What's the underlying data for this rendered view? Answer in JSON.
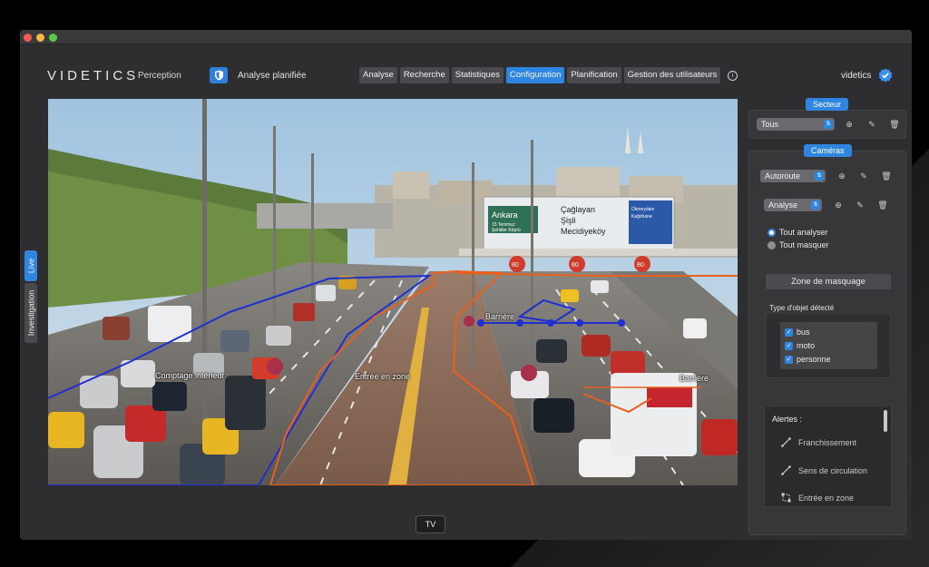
{
  "header": {
    "logo": "VIDETICS",
    "product": "Perception",
    "scheduled_label": "Analyse planifiée",
    "tabs": [
      {
        "label": "Analyse",
        "active": false
      },
      {
        "label": "Recherche",
        "active": false
      },
      {
        "label": "Statistiques",
        "active": false
      },
      {
        "label": "Configuration",
        "active": true
      },
      {
        "label": "Planification",
        "active": false
      },
      {
        "label": "Gestion des utilisateurs",
        "active": false
      }
    ],
    "info_icon": "i",
    "user": "videtics"
  },
  "side_tabs": {
    "live": "Live",
    "investigation": "Investigation"
  },
  "video": {
    "zones": {
      "counting": "Comptage intérieur",
      "entry": "Entrée en zone",
      "barrier_left": "Barrière",
      "barrier_right": "Barrière"
    },
    "signs": {
      "left": [
        "Ankara",
        "15 Temmuz",
        "Şehitler Köprü"
      ],
      "middle": [
        "Çağlayan",
        "Şişli",
        "Mecidiyeköy"
      ],
      "right": [
        "Okmeydanı",
        "Kağıthane"
      ],
      "speed": "80"
    }
  },
  "tv_button": "TV",
  "sector": {
    "title": "Secteur",
    "selected": "Tous"
  },
  "cameras": {
    "title": "Caméras",
    "camera_select": "Autoroute",
    "mode_select": "Analyse",
    "radio": [
      {
        "label": "Tout analyser",
        "checked": true
      },
      {
        "label": "Tout masquer",
        "checked": false
      }
    ],
    "mask_button": "Zone de masquage",
    "object_type_title": "Type d'objet détecté",
    "object_types": [
      "bus",
      "moto",
      "personne"
    ],
    "alerts_title": "Alertes :",
    "alerts": [
      "Franchissement",
      "Sens de circulation",
      "Entrée en zone"
    ]
  },
  "colors": {
    "accent": "#2f86e0",
    "zone_blue": "#1f2fd0",
    "zone_orange": "#e8601c"
  }
}
